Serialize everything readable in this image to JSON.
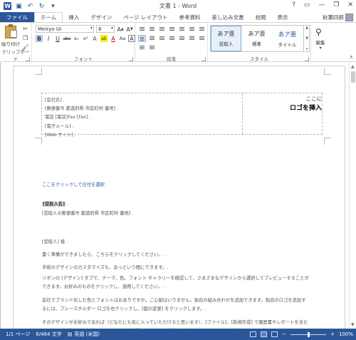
{
  "titlebar": {
    "title": "文書 1 - Word",
    "word_logo": "W",
    "qat_icons": [
      "save-icon",
      "undo-icon",
      "redo-icon",
      "customize-qat-icon"
    ],
    "window_buttons": [
      "?",
      "▭",
      "—",
      "❐",
      "✕"
    ]
  },
  "tabs": [
    "ファイル",
    "ホーム",
    "挿入",
    "デザイン",
    "ページ レイアウト",
    "参考資料",
    "差し込み文書",
    "校閲",
    "表示"
  ],
  "active_tab": "ホーム",
  "user": {
    "name": "秋葉四郎"
  },
  "ribbon": {
    "clipboard": {
      "paste_label": "貼り付け",
      "group_label": "クリップボード"
    },
    "font": {
      "font_name": "Meiryo UI",
      "font_size": "8",
      "group_label": "フォント",
      "buttons": [
        "B",
        "I",
        "U",
        "abc",
        "x₂",
        "x²",
        "A",
        "ab",
        "A",
        "Aa",
        "A"
      ]
    },
    "paragraph": {
      "group_label": "段落"
    },
    "styles": {
      "group_label": "スタイル",
      "items": [
        {
          "sample": "あア亜",
          "name": "受取人",
          "selected": true
        },
        {
          "sample": "あア亜",
          "name": "標準",
          "selected": false
        },
        {
          "sample": "あア亜",
          "name": "タイトル",
          "selected": false
        }
      ]
    },
    "editing": {
      "label": "編集"
    }
  },
  "document": {
    "header_address": [
      "[会社名] .",
      "[郵便番号 都道府県 市区町村 番地] .",
      "電話 [電話]Fax [Fax] .",
      "[電子メール] .",
      "[Web サイト] ."
    ],
    "logo_line1": "ここに",
    "logo_line2": "ロゴを挿入",
    "date_placeholder": "ここをクリックして日付を選択 .",
    "recipient_name": "[受取人名]",
    "recipient_address": "[受取人の郵便番号 都道府県 市区町村 番地] .",
    "salutation": "[受取人] 様 .",
    "p1": "書く準備ができましたら、こちらをクリックしてください。.",
    "p2": "手紙のデザインのカスタマイズも、あっという間にできます。.",
    "p3": "リボンの [デザイン] タブで、テーマ、色、フォント ギャラリーを確認して、さまざまなデザインから選択してプレビューすることができます。お好みのものをクリックし、適用してください。.",
    "p4": "会社でブランド化した色とフォントはおありですか。ご心配はいりません。独自の組み合わせを追加できます。独自のロゴを追加するには、プレースホルダー ロゴを右クリックし、[図の変更] をクリックします。.",
    "p5": "そのデザインがお好みであれば（どなたにも気に入っていただけると思います）、[ファイル]、[新規作成] で履歴書やレポートを含むのレターと調和するその他のテンプレートをご覧ください。本格的で、統一されたデザインの文書をすぐに作成できます。."
  },
  "statusbar": {
    "page": "1/1 ページ",
    "words": "6/464 文字",
    "language": "英語 (米国)",
    "zoom": "100%",
    "zoom_minus": "−",
    "zoom_plus": "+"
  }
}
